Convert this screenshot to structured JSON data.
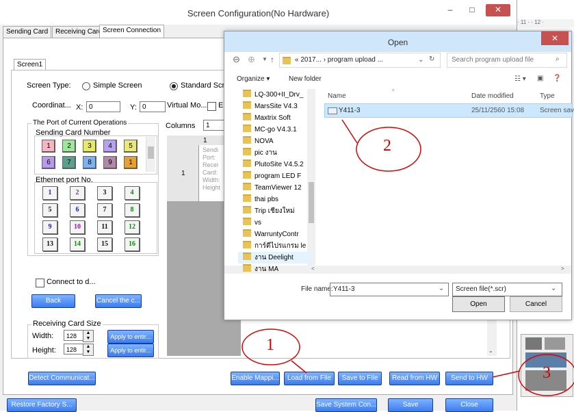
{
  "window": {
    "title": "Screen Configuration(No Hardware)",
    "minimize": "–",
    "maximize": "□",
    "close": "✕"
  },
  "tabs": [
    "Sending Card",
    "Receiving Card",
    "Screen Connection"
  ],
  "screen_tab": "Screen1",
  "screen_type": {
    "label": "Screen Type:",
    "option_simple": "Simple Screen",
    "option_standard": "Standard Scre",
    "selected": "Standard Scre"
  },
  "coords": {
    "label": "Coordinat...",
    "x_label": "X:",
    "x_value": "0",
    "y_label": "Y:",
    "y_value": "0",
    "virtual_label": "Virtual Mo...",
    "virtual_check_label": "E"
  },
  "columns": {
    "label": "Columns",
    "value": "1"
  },
  "port_group": {
    "title": "The Port of Current Operations",
    "sending_card_label": "Sending Card Number",
    "sending_cards": [
      {
        "n": "1",
        "color": "#f4b6c2"
      },
      {
        "n": "2",
        "color": "#9fe59c"
      },
      {
        "n": "3",
        "color": "#e8e86a"
      },
      {
        "n": "4",
        "color": "#b6a2f0"
      },
      {
        "n": "5",
        "color": "#e8e87e"
      },
      {
        "n": "6",
        "color": "#b89be8"
      },
      {
        "n": "7",
        "color": "#5f9e8f"
      },
      {
        "n": "8",
        "color": "#7fb0f0"
      },
      {
        "n": "9",
        "color": "#b08aa8"
      },
      {
        "n": "1",
        "color": "#e2a23a"
      }
    ],
    "ethernet_label": "Ethernet port No.",
    "ethernet_ports": [
      {
        "n": "1",
        "color": "#1a1ad6"
      },
      {
        "n": "2",
        "color": "#a01ac0"
      },
      {
        "n": "3",
        "color": "#111111"
      },
      {
        "n": "4",
        "color": "#118811"
      },
      {
        "n": "5",
        "color": "#111111"
      },
      {
        "n": "6",
        "color": "#1a1ad6"
      },
      {
        "n": "7",
        "color": "#111111"
      },
      {
        "n": "8",
        "color": "#118811"
      },
      {
        "n": "9",
        "color": "#1a1ad6"
      },
      {
        "n": "10",
        "color": "#a01ac0"
      },
      {
        "n": "11",
        "color": "#111111"
      },
      {
        "n": "12",
        "color": "#118811"
      },
      {
        "n": "13",
        "color": "#111111"
      },
      {
        "n": "14",
        "color": "#118811"
      },
      {
        "n": "15",
        "color": "#111111"
      },
      {
        "n": "16",
        "color": "#118811"
      }
    ]
  },
  "connect_check": "Connect to d...",
  "buttons": {
    "back": "Back",
    "cancel": "Cancel the c...",
    "apply1": "Apply to entir...",
    "apply2": "Apply to entir...",
    "detect": "Detect Communicat...",
    "enable_mapping": "Enable Mappi...",
    "load_from_file": "Load from File",
    "save_to_file": "Save to File",
    "read_from_hw": "Read from HW",
    "send_to_hw": "Send to HW",
    "restore": "Restore Factory S...",
    "save_system": "Save System Con...",
    "save": "Save",
    "close": "Close"
  },
  "receiving_size": {
    "title": "Receiving Card Size",
    "width_label": "Width:",
    "width_value": "128",
    "height_label": "Height:",
    "height_value": "128"
  },
  "grid": {
    "col_header": "1",
    "row_header": "1",
    "cell_lines": [
      "Sendi",
      "Port:",
      "Recei",
      "Card:",
      "Width:",
      "Height"
    ]
  },
  "dialog": {
    "title": "Open",
    "close": "✕",
    "path": "« 2017... › program upload ...",
    "search_placeholder": "Search program upload file",
    "organize": "Organize ▾",
    "new_folder": "New folder",
    "tree": [
      "LQ-300+II_Drv_",
      "MarsSite V4.3",
      "Maxtrix Soft",
      "MC-go V4.3.1",
      "NOVA",
      "pic งาน",
      "PlutoSite V4.5.2",
      "program LED F",
      "TeamViewer 12",
      "thai pbs",
      "Trip เชียงใหม่",
      "vs",
      "WarruntyContr",
      "การ์ดีไปรแกรม le",
      "งาน Deelight",
      "งาน MA"
    ],
    "columns": {
      "name": "Name",
      "date": "Date modified",
      "type": "Type"
    },
    "files": [
      {
        "name": "Y411-3",
        "date": "25/11/2560 15:08",
        "type": "Screen sav"
      }
    ],
    "filename_label": "File name:",
    "filename_value": "Y411-3",
    "filter": "Screen file(*.scr)",
    "open_btn": "Open",
    "cancel_btn": "Cancel"
  },
  "annotations": [
    "1",
    "2",
    "3"
  ],
  "right_strip": {
    "ruler": "· 11 · · 12 ·"
  }
}
